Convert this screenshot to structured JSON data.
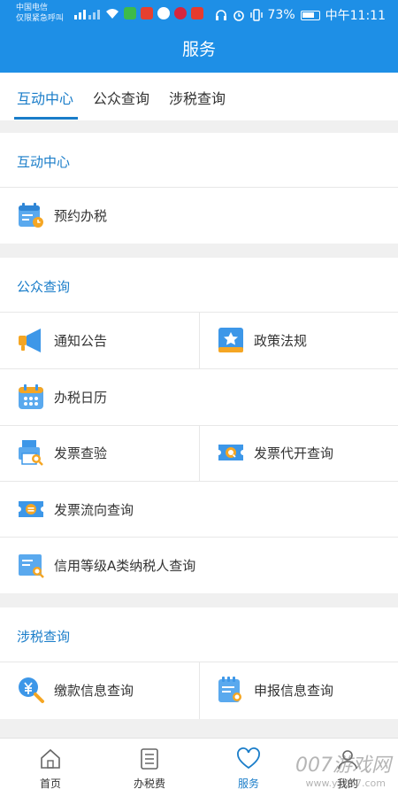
{
  "status_bar": {
    "carrier_line1": "中国电信",
    "carrier_line2": "仅限紧急呼叫",
    "battery": "73%",
    "time": "中午11:11"
  },
  "header": {
    "title": "服务"
  },
  "tabs": [
    {
      "label": "互动中心",
      "active": true
    },
    {
      "label": "公众查询",
      "active": false
    },
    {
      "label": "涉税查询",
      "active": false
    }
  ],
  "sections": {
    "interaction": {
      "title": "互动中心",
      "items": [
        {
          "label": "预约办税",
          "icon": "calendar-clock-icon"
        }
      ]
    },
    "public_query": {
      "title": "公众查询",
      "items": [
        {
          "label": "通知公告",
          "icon": "megaphone-icon"
        },
        {
          "label": "政策法规",
          "icon": "policy-book-icon"
        },
        {
          "label": "办税日历",
          "icon": "calendar-icon"
        },
        {
          "label": "发票查验",
          "icon": "invoice-check-icon"
        },
        {
          "label": "发票代开查询",
          "icon": "ticket-search-icon"
        },
        {
          "label": "发票流向查询",
          "icon": "ticket-icon"
        },
        {
          "label": "信用等级A类纳税人查询",
          "icon": "credit-search-icon"
        }
      ]
    },
    "tax_query": {
      "title": "涉税查询",
      "items": [
        {
          "label": "缴款信息查询",
          "icon": "payment-search-icon"
        },
        {
          "label": "申报信息查询",
          "icon": "declaration-search-icon"
        }
      ]
    }
  },
  "bottom_nav": [
    {
      "label": "首页",
      "icon": "home-icon",
      "active": false
    },
    {
      "label": "办税费",
      "icon": "list-icon",
      "active": false
    },
    {
      "label": "服务",
      "icon": "heart-icon",
      "active": true
    },
    {
      "label": "我的",
      "icon": "user-icon",
      "active": false
    }
  ],
  "watermark": {
    "main": "007游戏网",
    "sub": "www.yx007.com"
  },
  "colors": {
    "primary": "#1e8fe6",
    "accent": "#1a7dc9",
    "icon_orange": "#f5a623"
  }
}
